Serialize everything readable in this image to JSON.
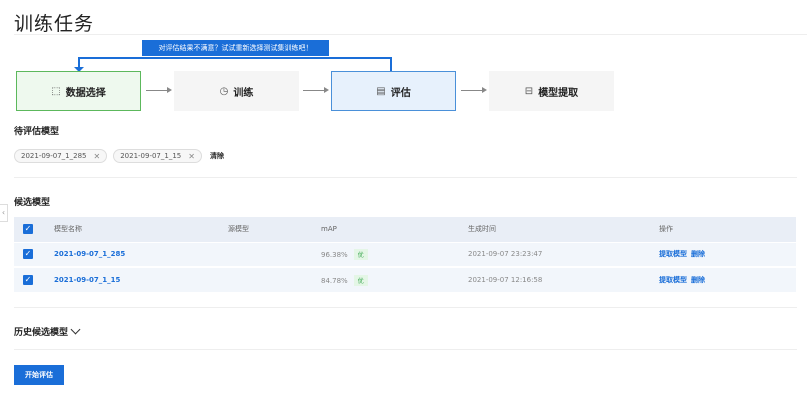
{
  "page": {
    "title": "训练任务"
  },
  "flow": {
    "feedback": "对评估结果不满意？试试重新选择测试集训练吧！",
    "steps": [
      {
        "label": "数据选择",
        "icon": "select-icon"
      },
      {
        "label": "训练",
        "icon": "timer-icon"
      },
      {
        "label": "评估",
        "icon": "chart-icon"
      },
      {
        "label": "模型提取",
        "icon": "extract-icon"
      }
    ]
  },
  "pending": {
    "title": "待评估模型",
    "chips": [
      "2021-09-07_1_285",
      "2021-09-07_1_15"
    ],
    "clear": "清除"
  },
  "candidates": {
    "title": "候选模型",
    "columns": [
      "模型名称",
      "源模型",
      "mAP",
      "生成时间",
      "操作"
    ],
    "rows": [
      {
        "name": "2021-09-07_1_285",
        "source": "",
        "map": "96.38%",
        "grade": "优",
        "time": "2021-09-07 23:23:47",
        "op1": "提取模型",
        "op2": "删除"
      },
      {
        "name": "2021-09-07_1_15",
        "source": "",
        "map": "84.78%",
        "grade": "优",
        "time": "2021-09-07 12:16:58",
        "op1": "提取模型",
        "op2": "删除"
      }
    ]
  },
  "history": {
    "title": "历史候选模型"
  },
  "actions": {
    "start": "开始评估"
  },
  "colors": {
    "primary": "#1a6ed8",
    "success": "#33a349"
  }
}
